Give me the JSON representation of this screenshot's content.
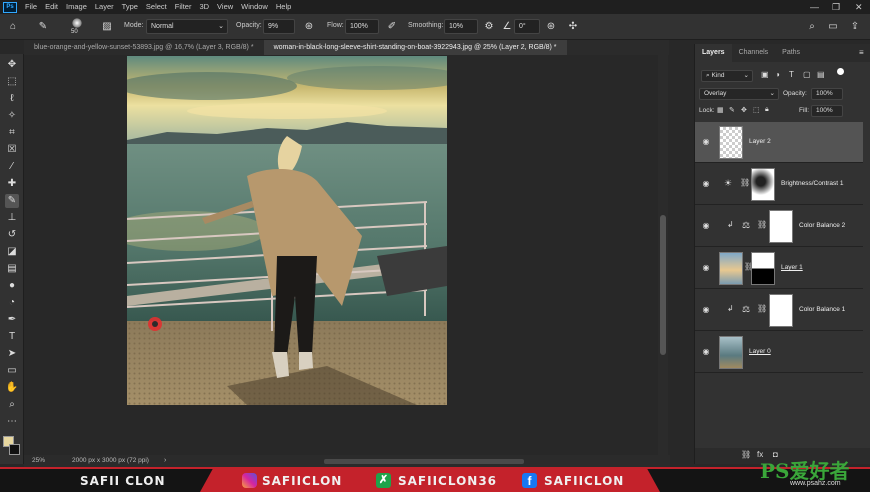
{
  "menubar": {
    "items": [
      "File",
      "Edit",
      "Image",
      "Layer",
      "Type",
      "Select",
      "Filter",
      "3D",
      "View",
      "Window",
      "Help"
    ]
  },
  "options": {
    "mode_label": "Mode:",
    "mode_value": "Normal",
    "opacity_label": "Opacity:",
    "opacity_value": "9%",
    "flow_label": "Flow:",
    "flow_value": "100%",
    "smoothing_label": "Smoothing:",
    "smoothing_value": "10%",
    "angle_value": "0°",
    "brush_size": "50"
  },
  "tabs": [
    {
      "label": "blue-orange-and-yellow-sunset-53893.jpg @ 16,7% (Layer 3, RGB/8) *"
    },
    {
      "label": "woman-in-black-long-sleeve-shirt-standing-on-boat-3922943.jpg @ 25% (Layer 2, RGB/8) *"
    }
  ],
  "status": {
    "zoom": "25%",
    "doc_info": "2000 px x 3000 px (72 ppi)"
  },
  "panels": {
    "tabs": [
      "Layers",
      "Channels",
      "Paths"
    ],
    "kind": "Kind",
    "blend_mode": "Overlay",
    "opacity_label": "Opacity:",
    "opacity_value": "100%",
    "lock_label": "Lock:",
    "fill_label": "Fill:",
    "fill_value": "100%",
    "layers": [
      {
        "name": "Layer 2"
      },
      {
        "name": "Brightness/Contrast 1"
      },
      {
        "name": "Color Balance 2"
      },
      {
        "name": "Layer 1"
      },
      {
        "name": "Color Balance 1"
      },
      {
        "name": "Layer 0"
      }
    ]
  },
  "banner": {
    "name": "SAFII CLON",
    "instagram": "SAFIICLON",
    "other": "SAFIICLON36",
    "facebook": "SAFIICLON",
    "watermark": "PS爱好者",
    "watermark_url": "www.psahz.com"
  },
  "colors": {
    "accent": "#c4222b",
    "ps_blue": "#31a8ff",
    "fg_swatch": "#e8d8a0"
  }
}
